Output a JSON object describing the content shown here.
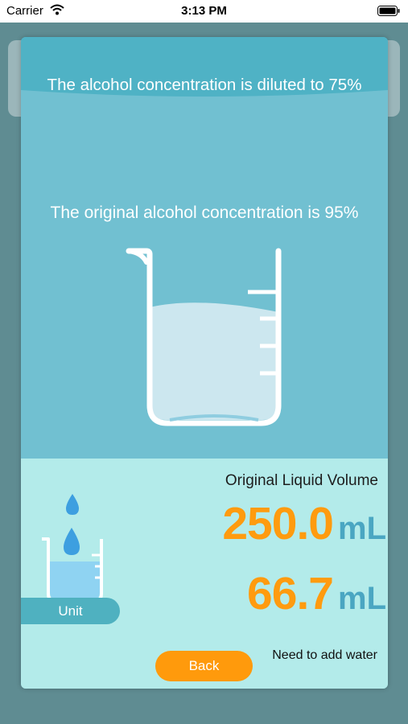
{
  "status_bar": {
    "carrier": "Carrier",
    "time": "3:13 PM"
  },
  "dilution": {
    "target_text": "The alcohol concentration is diluted to 75%",
    "original_text": "The original alcohol concentration is 95%",
    "volume_label": "Original Liquid Volume",
    "original_volume": "250.0",
    "original_unit": "mL",
    "water_volume": "66.7",
    "water_unit": "mL",
    "water_label": "Need to add water",
    "unit_button": "Unit",
    "back_button": "Back"
  },
  "colors": {
    "accent_orange": "#ff9b0f",
    "unit_blue": "#4aa6c2",
    "panel_teal": "#71c0d1",
    "bottom_panel": "#b3ebea"
  },
  "icons": [
    "wifi-icon",
    "battery-icon",
    "beaker-icon",
    "water-drop-icon"
  ]
}
